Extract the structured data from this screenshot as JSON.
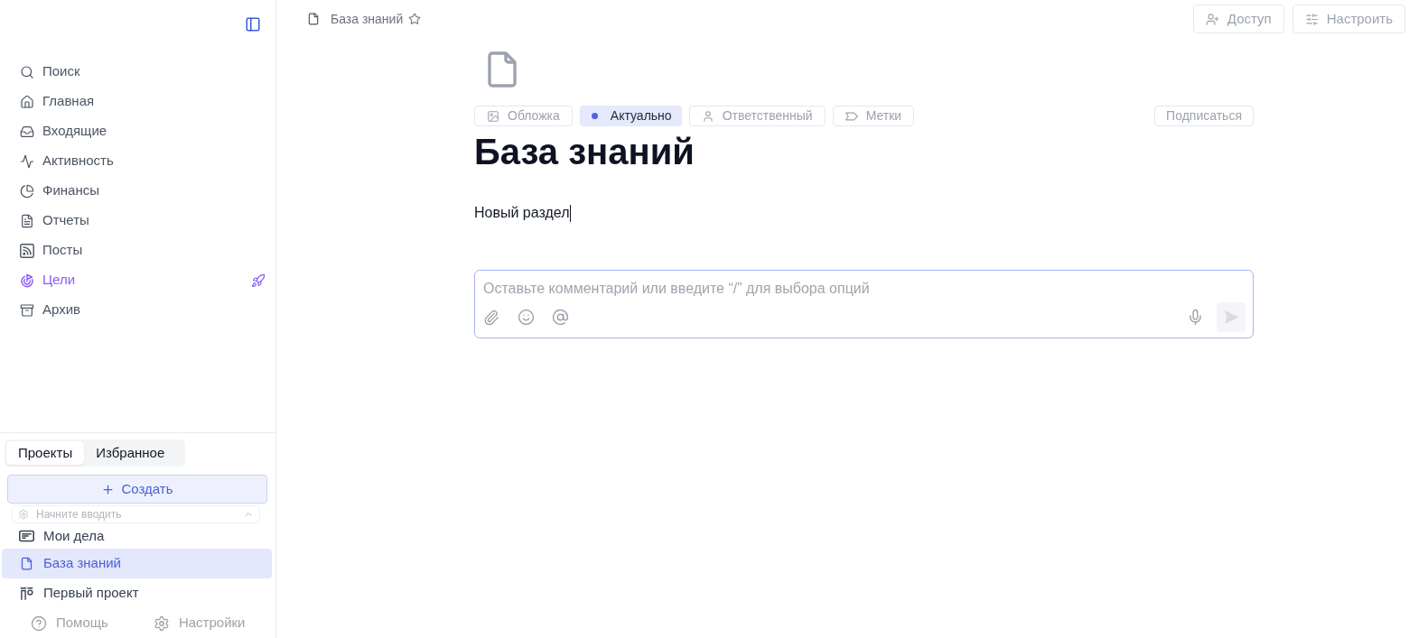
{
  "sidebar": {
    "nav_items": [
      {
        "label": "Поиск",
        "kind": "link"
      },
      {
        "label": "Главная",
        "kind": "link"
      },
      {
        "label": "Входящие",
        "kind": "link"
      },
      {
        "label": "Активность",
        "kind": "link"
      },
      {
        "label": "Финансы",
        "kind": "link"
      },
      {
        "label": "Отчеты",
        "kind": "link"
      },
      {
        "label": "Посты",
        "kind": "link"
      },
      {
        "label": "Цели",
        "kind": "promo"
      },
      {
        "label": "Архив",
        "kind": "link"
      }
    ],
    "tabs": [
      {
        "label": "Проекты",
        "selected": true
      },
      {
        "label": "Избранное",
        "selected": false
      }
    ],
    "create_button": "Создать",
    "search": {
      "placeholder": "Начните вводить"
    },
    "projects": [
      {
        "label": "Мои дела",
        "selected": false
      },
      {
        "label": "База знаний",
        "selected": true
      },
      {
        "label": "Первый проект",
        "selected": false
      }
    ],
    "footer": [
      {
        "label": "Помощь"
      },
      {
        "label": "Настройки"
      }
    ]
  },
  "topbar": {
    "breadcrumb": "База знаний",
    "favorite": false,
    "buttons": [
      "Доступ",
      "Настроить"
    ]
  },
  "document": {
    "properties": [
      {
        "label": "Обложка",
        "kind": "button"
      },
      {
        "label": "Актуально",
        "kind": "status",
        "color": "#4f63e7"
      },
      {
        "label": "Ответственный",
        "kind": "button"
      },
      {
        "label": "Метки",
        "kind": "button"
      }
    ],
    "subscribe_button": "Подписаться",
    "title": "База знаний",
    "body": {
      "text": "Новый раздел",
      "cursor": true
    }
  },
  "comment": {
    "placeholder": "Оставьте комментарий или введите “/” для выбора опций"
  }
}
